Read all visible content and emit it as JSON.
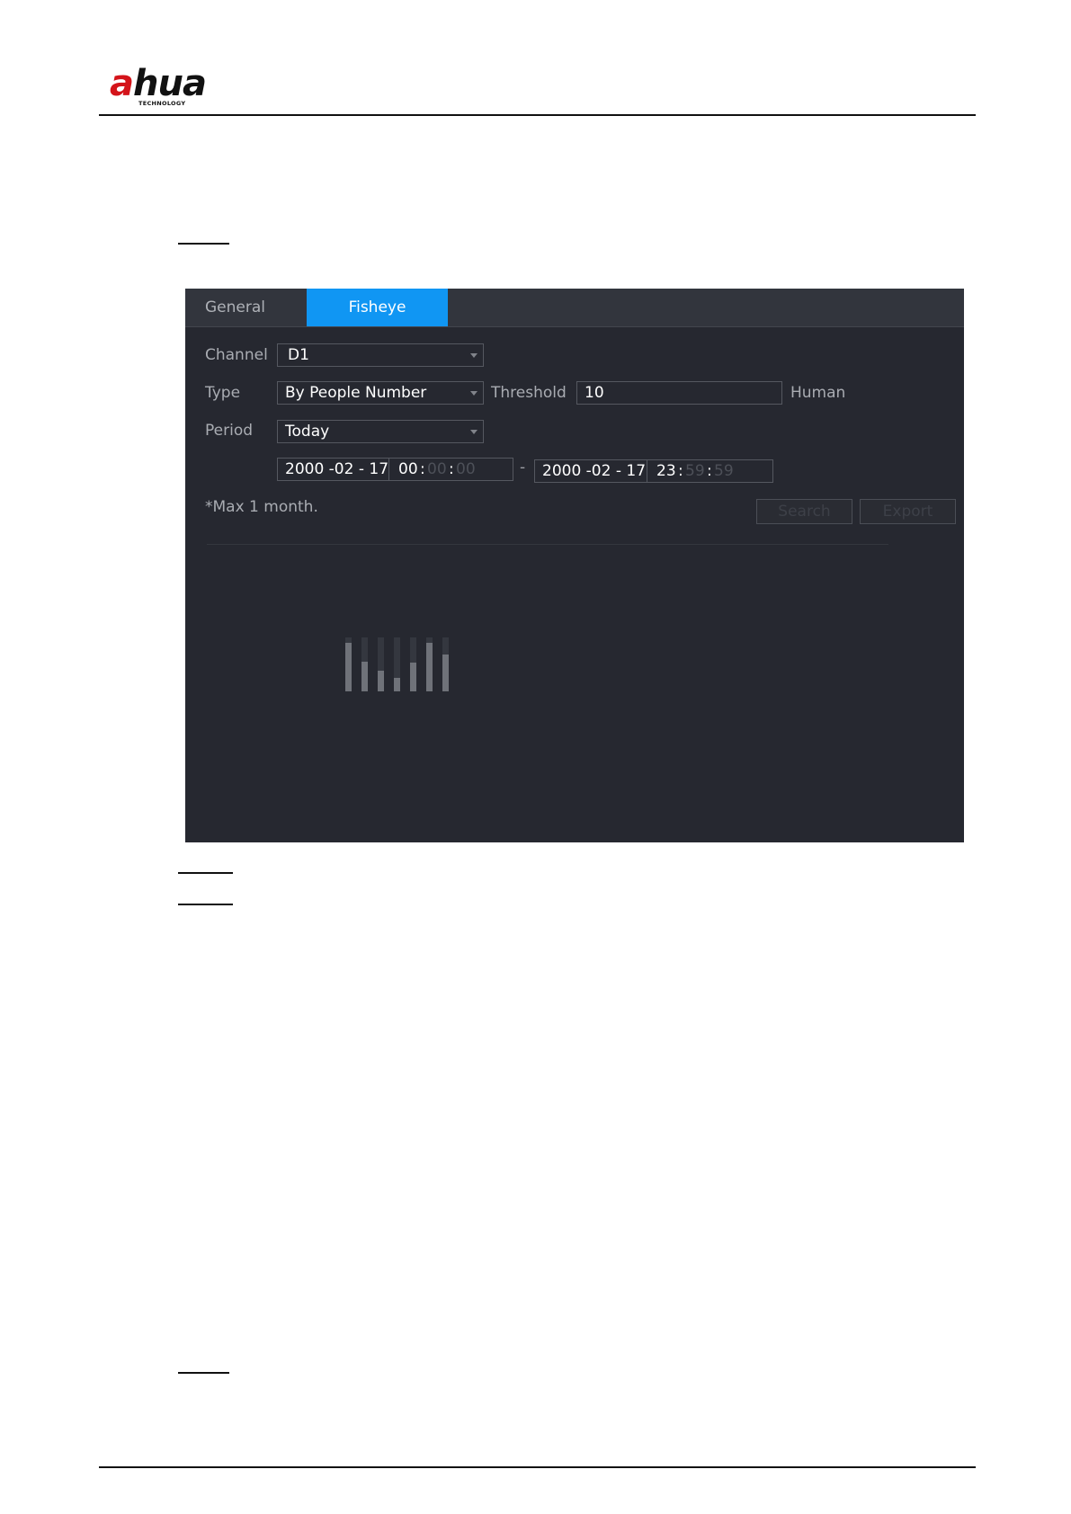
{
  "brand": {
    "name_prefix": "a",
    "name_suffix": "hua",
    "tagline": "TECHNOLOGY"
  },
  "tabs": [
    {
      "label": "General",
      "active": false
    },
    {
      "label": "Fisheye",
      "active": true
    }
  ],
  "form": {
    "channel_label": "Channel",
    "channel_value": "D1",
    "type_label": "Type",
    "type_value": "By People Number",
    "threshold_label": "Threshold",
    "threshold_value": "10",
    "threshold_unit": "Human",
    "period_label": "Period",
    "period_value": "Today",
    "start_date": "2000 -02 - 17",
    "start_hour": "00",
    "start_minute": "00",
    "start_second": "00",
    "range_separator": "-",
    "end_date": "2000 -02 - 17",
    "end_hour": "23",
    "end_minute": "59",
    "end_second": "59",
    "time_colon": ":",
    "note": "*Max 1 month."
  },
  "buttons": {
    "search": "Search",
    "export": "Export"
  },
  "loading_indicator": {
    "levels": [
      1.0,
      0.62,
      0.42,
      0.28,
      0.6,
      1.0,
      0.75
    ]
  },
  "colors": {
    "accent": "#1096f3",
    "panel_bg": "#262830",
    "brand_red": "#d4141a"
  }
}
